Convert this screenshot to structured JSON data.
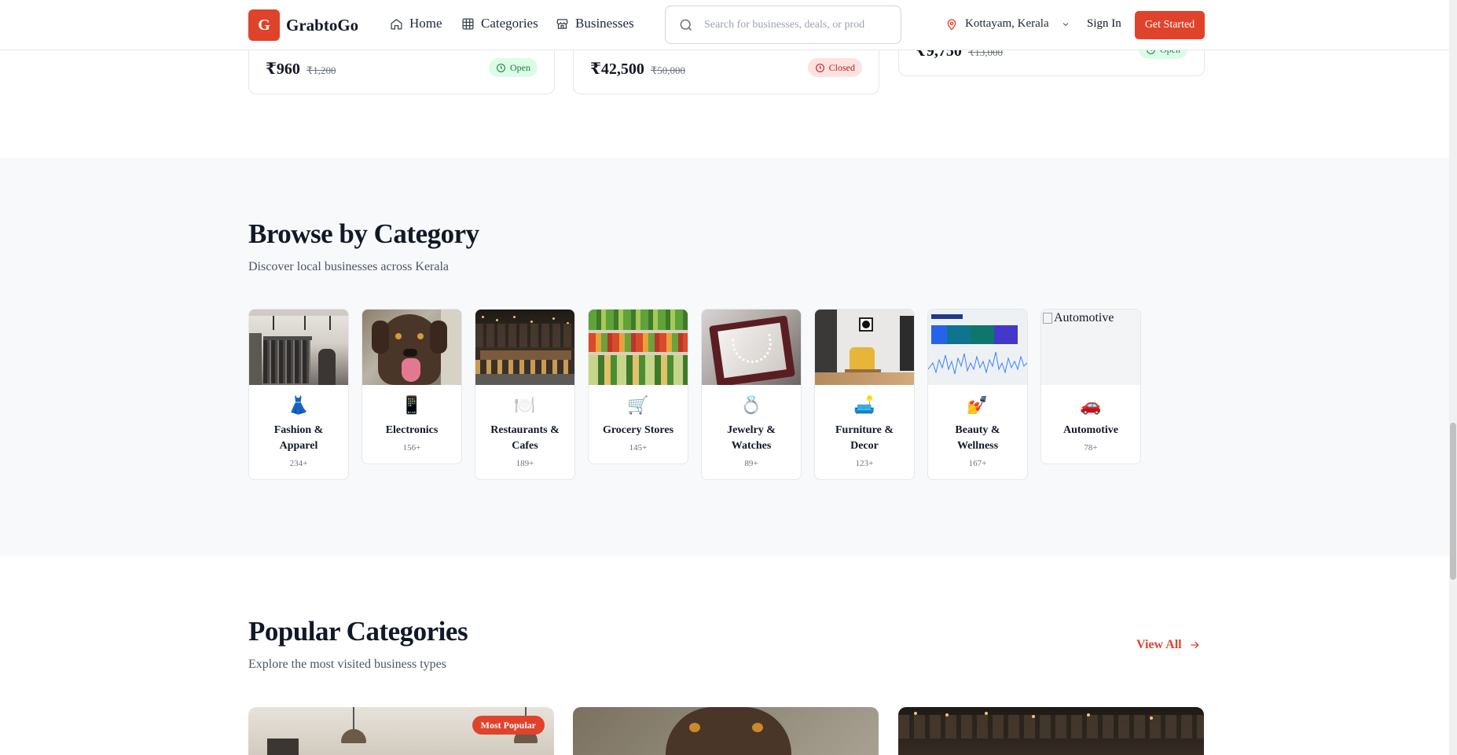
{
  "header": {
    "logo_letter": "G",
    "brand": "GrabtoGo",
    "nav": [
      {
        "label": "Home",
        "icon": "home-icon"
      },
      {
        "label": "Categories",
        "icon": "grid-icon"
      },
      {
        "label": "Businesses",
        "icon": "store-icon"
      }
    ],
    "search_placeholder": "Search for businesses, deals, or prod",
    "location": "Kottayam, Kerala",
    "sign_in": "Sign In",
    "get_started": "Get Started",
    "accent_color": "#e0432b"
  },
  "deals": [
    {
      "price": "₹960",
      "original": "₹1,200",
      "status": "Open"
    },
    {
      "price": "₹42,500",
      "original": "₹50,000",
      "status": "Closed"
    },
    {
      "price": "₹9,750",
      "original": "₹13,000",
      "status": "Open"
    }
  ],
  "browse": {
    "title": "Browse by Category",
    "subtitle": "Discover local businesses across Kerala",
    "categories": [
      {
        "name": "Fashion & Apparel",
        "count": "234+",
        "icon": "👗"
      },
      {
        "name": "Electronics",
        "count": "156+",
        "icon": "📱"
      },
      {
        "name": "Restaurants & Cafes",
        "count": "189+",
        "icon": "🍽️"
      },
      {
        "name": "Grocery Stores",
        "count": "145+",
        "icon": "🛒"
      },
      {
        "name": "Jewelry & Watches",
        "count": "89+",
        "icon": "💍"
      },
      {
        "name": "Furniture & Decor",
        "count": "123+",
        "icon": "🛋️"
      },
      {
        "name": "Beauty & Wellness",
        "count": "167+",
        "icon": "💅"
      },
      {
        "name": "Automotive",
        "count": "78+",
        "icon": "🚗",
        "broken_image_alt": "Automotive"
      }
    ]
  },
  "popular": {
    "title": "Popular Categories",
    "subtitle": "Explore the most visited business types",
    "view_all": "View All",
    "badge": "Most Popular"
  }
}
